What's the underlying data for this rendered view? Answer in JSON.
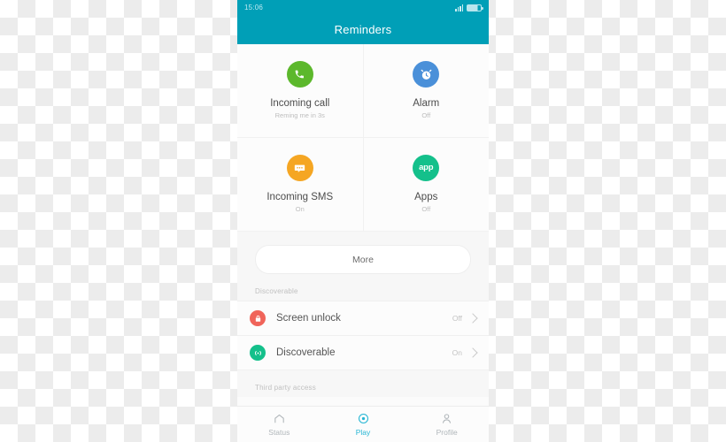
{
  "theme": {
    "header_teal": "#009fb7",
    "active_teal": "#26b6d4",
    "page_bg": "#f7f7f7",
    "card_bg": "#fcfcfc"
  },
  "statusbar": {
    "time": "15:06",
    "signal_icon": "signal-bars-icon",
    "battery_icon": "battery-icon"
  },
  "header": {
    "title": "Reminders"
  },
  "tiles": [
    {
      "title": "Incoming call",
      "subtitle": "Reming me in 3s",
      "icon": "phone-icon",
      "icon_color": "#5cb82c"
    },
    {
      "title": "Alarm",
      "subtitle": "Off",
      "icon": "alarm-clock-icon",
      "icon_color": "#4a90d9"
    },
    {
      "title": "Incoming SMS",
      "subtitle": "On",
      "icon": "chat-bubble-icon",
      "icon_color": "#f5a623"
    },
    {
      "title": "Apps",
      "subtitle": "Off",
      "icon": "app-badge-icon",
      "icon_glyph": "app",
      "icon_color": "#14c08b"
    }
  ],
  "more_button": {
    "label": "More"
  },
  "sections": [
    {
      "header": "Discoverable",
      "rows": [
        {
          "label": "Screen unlock",
          "value": "Off",
          "icon": "lock-icon",
          "icon_color": "#f0645a",
          "chevron": "chevron-right-icon"
        },
        {
          "label": "Discoverable",
          "value": "On",
          "icon": "broadcast-icon",
          "icon_color": "#14c08b",
          "chevron": "chevron-right-icon"
        }
      ]
    },
    {
      "header": "Third party access",
      "rows": []
    }
  ],
  "tabbar": {
    "tabs": [
      {
        "label": "Status",
        "icon": "home-icon",
        "active": false
      },
      {
        "label": "Play",
        "icon": "target-dot-icon",
        "active": true
      },
      {
        "label": "Profile",
        "icon": "person-icon",
        "active": false
      }
    ]
  }
}
